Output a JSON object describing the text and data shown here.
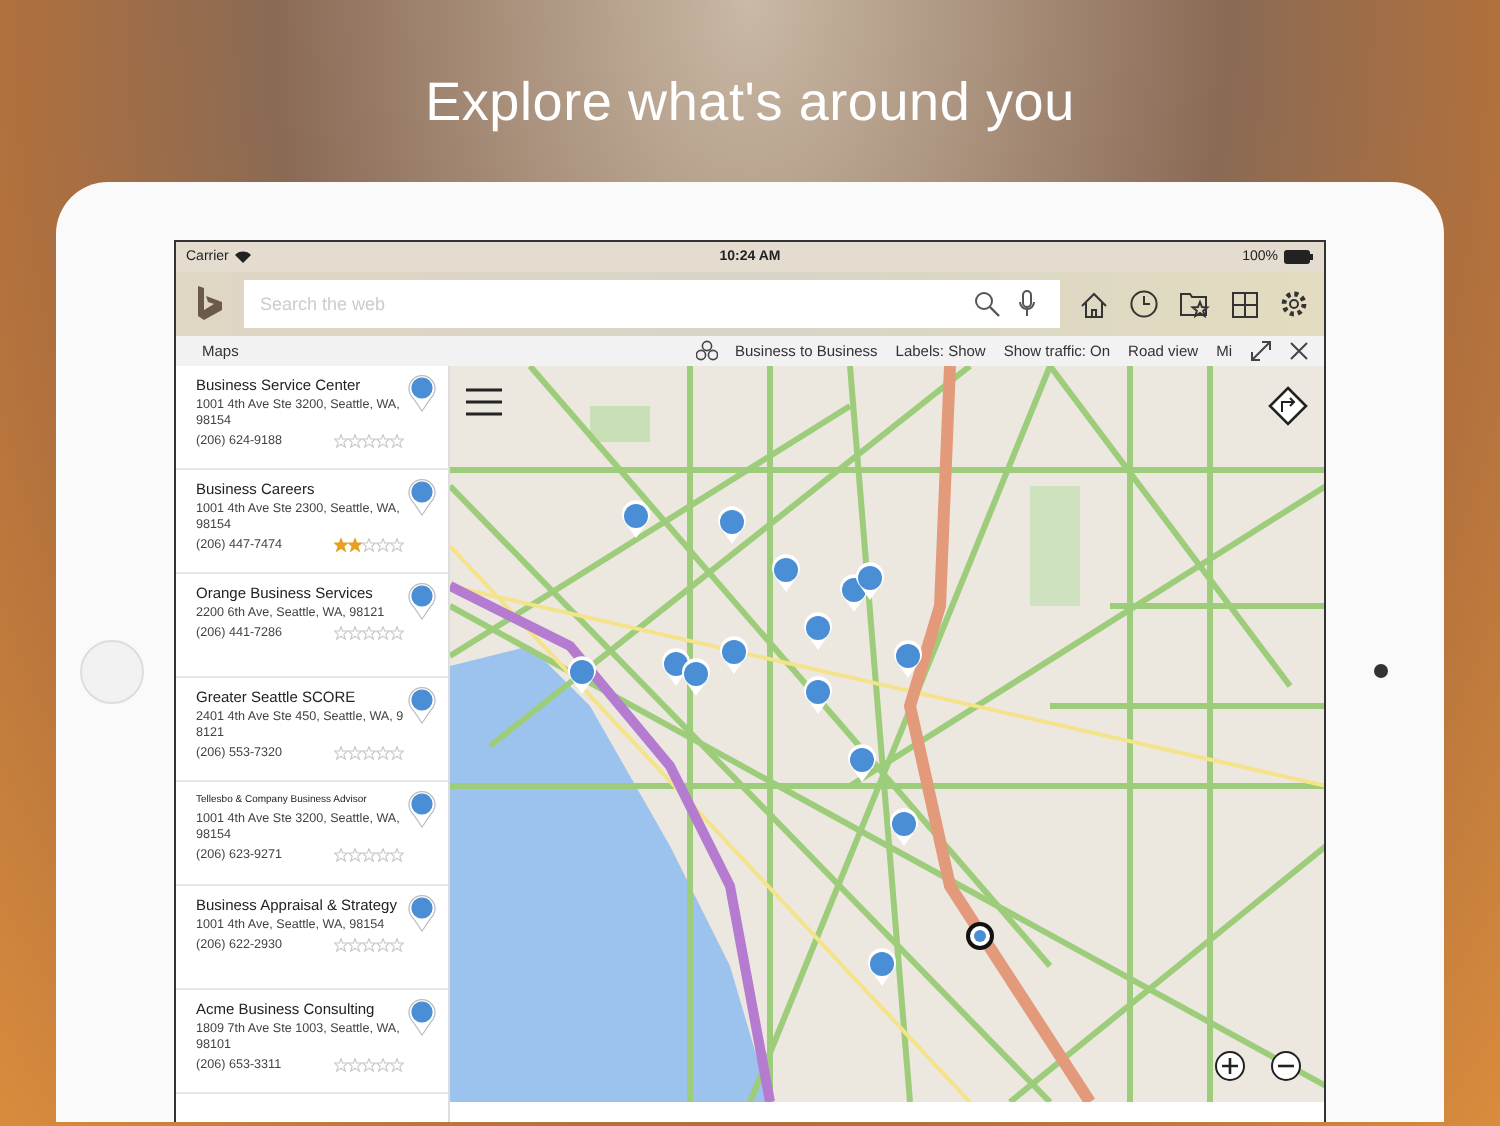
{
  "headline": "Explore what's around you",
  "status_bar": {
    "carrier": "Carrier",
    "time": "10:24 AM",
    "battery": "100%"
  },
  "search": {
    "placeholder": "Search the web"
  },
  "toolbar": {
    "title": "Maps",
    "items": [
      "Business to Business",
      "Labels: Show",
      "Show traffic: On",
      "Road view",
      "Mi"
    ]
  },
  "results": [
    {
      "name": "Business Service Center",
      "address": "1001 4th Ave Ste 3200, Seattle, WA, 98154",
      "phone": "(206) 624-9188",
      "stars": 0
    },
    {
      "name": "Business Careers",
      "address": "1001 4th Ave Ste 2300, Seattle, WA, 98154",
      "phone": "(206) 447-7474",
      "stars": 2
    },
    {
      "name": "Orange Business Services",
      "address": "2200 6th Ave, Seattle, WA, 98121",
      "phone": "(206) 441-7286",
      "stars": 0
    },
    {
      "name": "Greater Seattle SCORE",
      "address": "2401 4th Ave Ste 450, Seattle, WA, 98121",
      "phone": "(206) 553-7320",
      "stars": 0
    },
    {
      "name": "Tellesbo & Company Business Advisor",
      "address": "1001 4th Ave Ste 3200, Seattle, WA, 98154",
      "phone": "(206) 623-9271",
      "stars": 0
    },
    {
      "name": "Business Appraisal & Strategy",
      "address": "1001 4th Ave, Seattle, WA, 98154",
      "phone": "(206) 622-2930",
      "stars": 0
    },
    {
      "name": "Acme Business Consulting",
      "address": "1809 7th Ave Ste 1003, Seattle, WA, 98101",
      "phone": "(206) 653-3311",
      "stars": 0
    }
  ]
}
